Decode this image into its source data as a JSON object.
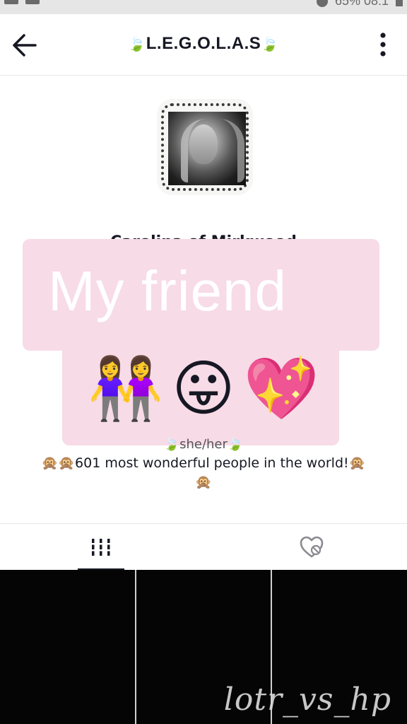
{
  "status_bar": {
    "right_text": "65%  08:1"
  },
  "header": {
    "title_prefix_leaf": "🍃",
    "title": "L.E.G.O.L.A.S",
    "title_suffix_leaf": "🍃"
  },
  "profile": {
    "name_hidden": "Carolina of Mirkwood"
  },
  "overlay": {
    "caption": "My friend",
    "emojis": [
      "👭",
      "😛",
      "💖"
    ]
  },
  "bio": {
    "pronouns": "🍃she/her🍃",
    "line": "🙊🙊601 most wonderful people in the world!🙊",
    "line2": "🙊"
  },
  "tabs": [
    {
      "name": "videos",
      "icon": "grid-bars-icon",
      "selected": true
    },
    {
      "name": "liked",
      "icon": "heart-hidden-icon",
      "selected": false
    }
  ],
  "watermark": "lotr_vs_hp"
}
